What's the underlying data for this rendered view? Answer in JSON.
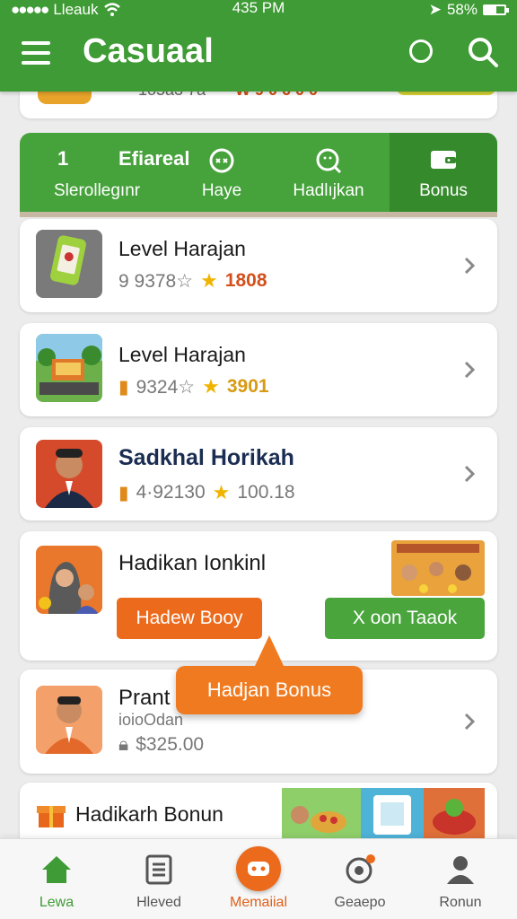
{
  "status": {
    "carrier": "Lleauk",
    "time": "435 PM",
    "battery": "58%"
  },
  "header": {
    "title": "Casuaal"
  },
  "partial": {
    "text1": "1o5a3 7a",
    "text2": "₩ 9 0 6 0 0"
  },
  "tabs": [
    {
      "num": "1",
      "name": "Efiareal",
      "label": "Slerollegınr"
    },
    {
      "label": "Haye"
    },
    {
      "label": "Hadlıjkan"
    },
    {
      "label": "Bonus"
    }
  ],
  "cards": [
    {
      "title": "Level Harajan",
      "meta_num": "9 9378☆",
      "meta_score": "1808"
    },
    {
      "title": "Level Harajan",
      "meta_num": "9324☆",
      "meta_score": "3901"
    },
    {
      "title": "Sadkhal Horikah",
      "meta_num": "4·92130",
      "meta_score": "100.18"
    },
    {
      "title": "Hadikan Ionkinl",
      "btn_left": "Hadew Booy",
      "btn_right": "X oon Taaok"
    },
    {
      "title": "Prant",
      "subtitle": "ioioOdan",
      "price": "$325.00"
    },
    {
      "title": "Hadikarh Bonun"
    }
  ],
  "tooltip": "Hadjan Bonus",
  "bottom_nav": [
    {
      "label": "Lewa"
    },
    {
      "label": "Hleved"
    },
    {
      "label": "Memaiial"
    },
    {
      "label": "Geaepo"
    },
    {
      "label": "Ronun"
    }
  ],
  "colors": {
    "brand_green": "#3f9b35",
    "accent_orange": "#ec6a1c",
    "score_red": "#d4501c",
    "gold": "#f0b400"
  }
}
